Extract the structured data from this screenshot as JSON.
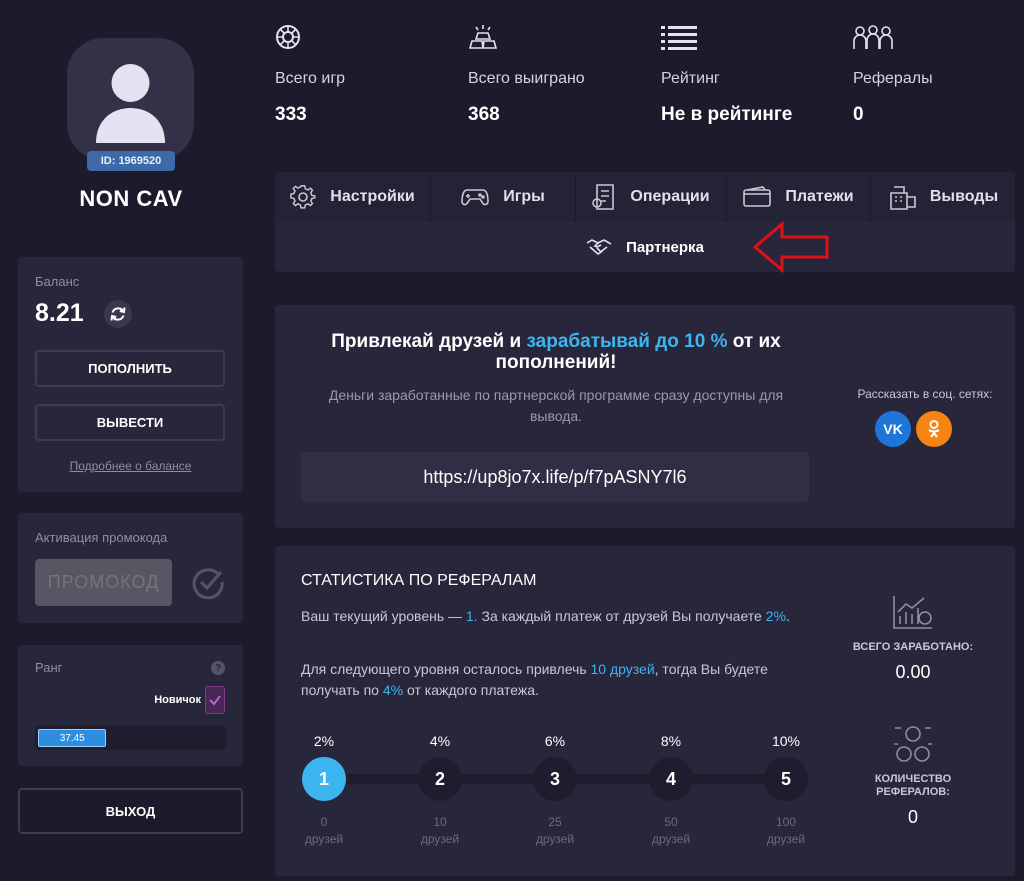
{
  "profile": {
    "id_label": "ID: 1969520",
    "username": "NON CAV"
  },
  "balance": {
    "label": "Баланс",
    "value": "8.21",
    "deposit_label": "ПОПОЛНИТЬ",
    "withdraw_label": "ВЫВЕСТИ",
    "details_link": "Подробнее о балансе"
  },
  "promo": {
    "label": "Активация промокода",
    "placeholder": "ПРОМОКОД"
  },
  "rank": {
    "label": "Ранг",
    "help": "?",
    "name": "Новичок",
    "progress_text": "37.45",
    "progress_fraction": 0.37
  },
  "logout_label": "ВЫХОД",
  "stats": [
    {
      "icon": "wheel-icon",
      "label": "Всего игр",
      "value": "333"
    },
    {
      "icon": "gold-bars-icon",
      "label": "Всего выиграно",
      "value": "368"
    },
    {
      "icon": "list-icon",
      "label": "Рейтинг",
      "value": "Не в рейтинге"
    },
    {
      "icon": "people-icon",
      "label": "Рефералы",
      "value": "0"
    }
  ],
  "tabs": [
    {
      "icon": "gear-icon",
      "label": "Настройки"
    },
    {
      "icon": "gamepad-icon",
      "label": "Игры"
    },
    {
      "icon": "receipt-icon",
      "label": "Операции"
    },
    {
      "icon": "wallet-icon",
      "label": "Платежи"
    },
    {
      "icon": "cash-register-icon",
      "label": "Выводы"
    }
  ],
  "active_tab": {
    "icon": "handshake-icon",
    "label": "Партнерка"
  },
  "referral": {
    "title_part1": "Привлекай друзей и ",
    "title_accent": "зарабатывай до 10 %",
    "title_part2": " от их пополнений!",
    "description": "Деньги заработанные по партнерской программе сразу доступны для вывода.",
    "link": "https://up8jo7x.life/p/f7pASNY7l6",
    "share_label": "Рассказать в соц. сетях:",
    "vk_label": "VK",
    "ok_label": "ОК"
  },
  "referral_stats": {
    "title": "СТАТИСТИКА ПО РЕФЕРАЛАМ",
    "p1_a": "Ваш текущий уровень — ",
    "p1_level": "1.",
    "p1_b": " За каждый платеж от друзей Вы получаете ",
    "p1_pct": "2%",
    "p1_c": ".",
    "p2_a": "Для следующего уровня осталось привлечь ",
    "p2_friends": "10 друзей",
    "p2_b": ", тогда Вы будете получать по ",
    "p2_pct": "4%",
    "p2_c": " от каждого платежа.",
    "levels": [
      {
        "num": "1",
        "pct": "2%",
        "friends": "0",
        "unit": "друзей"
      },
      {
        "num": "2",
        "pct": "4%",
        "friends": "10",
        "unit": "друзей"
      },
      {
        "num": "3",
        "pct": "6%",
        "friends": "25",
        "unit": "друзей"
      },
      {
        "num": "4",
        "pct": "8%",
        "friends": "50",
        "unit": "друзей"
      },
      {
        "num": "5",
        "pct": "10%",
        "friends": "100",
        "unit": "друзей"
      }
    ],
    "active_level": 1,
    "earned_label": "ВСЕГО ЗАРАБОТАНО:",
    "earned_value": "0.00",
    "count_label": "КОЛИЧЕСТВО РЕФЕРАЛОВ:",
    "count_value": "0"
  },
  "colors": {
    "background": "#1c1b2b",
    "card": "#28263b",
    "accent": "#3db5f0",
    "arrow": "#e0101a"
  }
}
